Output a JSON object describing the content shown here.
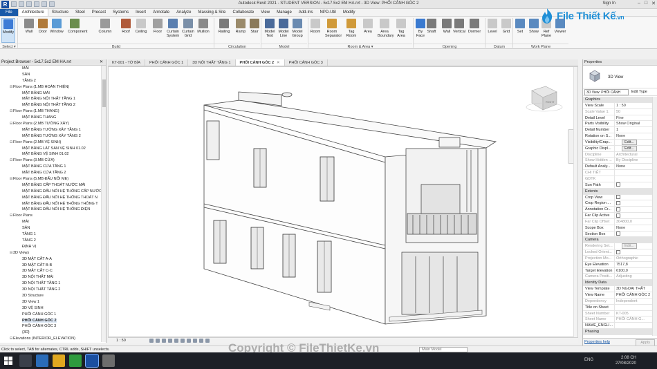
{
  "titlebar": {
    "app_title": "Autodesk Revit 2021 - STUDENT VERSION - 5x17.5x2 EM HA.rvt - 3D View: PHỐI CẢNH GÓC 2",
    "sign_in": "Sign In"
  },
  "brand": {
    "name": "File Thiết Kế",
    "suffix": ".vn"
  },
  "ribbon_tabs": [
    "File",
    "Architecture",
    "Structure",
    "Steel",
    "Precast",
    "Systems",
    "Insert",
    "Annotate",
    "Analyze",
    "Massing & Site",
    "Collaborate",
    "View",
    "Manage",
    "Add-Ins",
    "NPD-Util",
    "Modify"
  ],
  "ribbon_tools": [
    {
      "label": "Modify",
      "icon": "modify-cursor-icon"
    },
    {
      "label": "Wall",
      "icon": "wall-icon"
    },
    {
      "label": "Door",
      "icon": "door-icon"
    },
    {
      "label": "Window",
      "icon": "window-icon"
    },
    {
      "label": "Component",
      "icon": "component-icon"
    },
    {
      "label": "Column",
      "icon": "column-icon"
    },
    {
      "label": "Roof",
      "icon": "roof-icon"
    },
    {
      "label": "Ceiling",
      "icon": "ceiling-icon"
    },
    {
      "label": "Floor",
      "icon": "floor-icon"
    },
    {
      "label": "Curtain System",
      "icon": "curtain-system-icon"
    },
    {
      "label": "Curtain Grid",
      "icon": "curtain-grid-icon"
    },
    {
      "label": "Mullion",
      "icon": "mullion-icon"
    },
    {
      "label": "Railing",
      "icon": "railing-icon"
    },
    {
      "label": "Ramp",
      "icon": "ramp-icon"
    },
    {
      "label": "Stair",
      "icon": "stair-icon"
    },
    {
      "label": "Model Text",
      "icon": "model-text-icon"
    },
    {
      "label": "Model Line",
      "icon": "model-line-icon"
    },
    {
      "label": "Model Group",
      "icon": "model-group-icon"
    },
    {
      "label": "Room",
      "icon": "room-icon"
    },
    {
      "label": "Room Separator",
      "icon": "room-separator-icon"
    },
    {
      "label": "Tag Room",
      "icon": "tag-room-icon"
    },
    {
      "label": "Area",
      "icon": "area-icon"
    },
    {
      "label": "Area Boundary",
      "icon": "area-boundary-icon"
    },
    {
      "label": "Tag Area",
      "icon": "tag-area-icon"
    },
    {
      "label": "By Face",
      "icon": "by-face-icon"
    },
    {
      "label": "Shaft",
      "icon": "shaft-icon"
    },
    {
      "label": "Wall",
      "icon": "opening-wall-icon"
    },
    {
      "label": "Vertical",
      "icon": "vertical-icon"
    },
    {
      "label": "Dormer",
      "icon": "dormer-icon"
    },
    {
      "label": "Level",
      "icon": "level-icon"
    },
    {
      "label": "Grid",
      "icon": "grid-icon"
    },
    {
      "label": "Set",
      "icon": "set-icon"
    },
    {
      "label": "Show",
      "icon": "show-icon"
    },
    {
      "label": "Ref Plane",
      "icon": "ref-plane-icon"
    },
    {
      "label": "Viewer",
      "icon": "viewer-icon"
    }
  ],
  "ribbon_groups": [
    "Select ▾",
    "Build",
    "Circulation",
    "Model",
    "Room & Area ▾",
    "Opening",
    "Datum",
    "Work Plane"
  ],
  "project_browser": {
    "title": "Project Browser - 5x17.5x2 EM HA.rvt",
    "items": [
      {
        "label": "MÁI",
        "level": 2
      },
      {
        "label": "SÂN",
        "level": 2
      },
      {
        "label": "TẦNG 2",
        "level": 2
      },
      {
        "label": "Floor Plans (1.MB HOÀN THIỆN)",
        "level": 1
      },
      {
        "label": "MẶT BẰNG MÁI",
        "level": 2
      },
      {
        "label": "MẶT BẰNG NỘI THẤT TẦNG 1",
        "level": 2
      },
      {
        "label": "MẶT BẰNG NỘI THẤT TẦNG 2",
        "level": 2
      },
      {
        "label": "Floor Plans (1.MB THANG)",
        "level": 1
      },
      {
        "label": "MẶT BẰNG THANG",
        "level": 2
      },
      {
        "label": "Floor Plans (2.MB TƯỜNG XÂY)",
        "level": 1
      },
      {
        "label": "MẶT BẰNG TƯỜNG XÂY TẦNG 1",
        "level": 2
      },
      {
        "label": "MẶT BẰNG TƯỜNG XÂY TẦNG 2",
        "level": 2
      },
      {
        "label": "Floor Plans (2.MB VỆ SINH)",
        "level": 1
      },
      {
        "label": "MẶT BẰNG LÁT SÀN VỆ SINH 01.02",
        "level": 2
      },
      {
        "label": "MẶT BẰNG VỆ SINH 01.02",
        "level": 2
      },
      {
        "label": "Floor Plans (3.MB CỬA)",
        "level": 1
      },
      {
        "label": "MẶT BẰNG CỬA TẦNG 1",
        "level": 2
      },
      {
        "label": "MẶT BẰNG CỬA TẦNG 2",
        "level": 2
      },
      {
        "label": "Floor Plans (5.MB ĐẤU NỐI ME)",
        "level": 1
      },
      {
        "label": "MẶT BẰNG CẤP THOÁT NƯỚC MÁI",
        "level": 2
      },
      {
        "label": "MẶT BẰNG ĐẤU NỐI HỆ THỐNG CẤP NƯỚC",
        "level": 2
      },
      {
        "label": "MẶT BẰNG ĐẤU NỐI HỆ THỐNG THOÁT N",
        "level": 2
      },
      {
        "label": "MẶT BẰNG ĐẤU NỐI HỆ THỐNG THÔNG T",
        "level": 2
      },
      {
        "label": "MẶT BẰNG ĐẤU NỐI HỆ THỐNG ĐIỆN",
        "level": 2
      },
      {
        "label": "Floor Plans",
        "level": 1
      },
      {
        "label": "MÁI",
        "level": 2
      },
      {
        "label": "SÂN",
        "level": 2
      },
      {
        "label": "TẦNG 1",
        "level": 2
      },
      {
        "label": "TẦNG 2",
        "level": 2
      },
      {
        "label": "ĐỊNH VỊ",
        "level": 2
      },
      {
        "label": "3D Views",
        "level": 1
      },
      {
        "label": "3D MẶT CẮT A-A",
        "level": 2
      },
      {
        "label": "3D MẶT CẮT B-B",
        "level": 2
      },
      {
        "label": "3D MẶT CẮT C-C",
        "level": 2
      },
      {
        "label": "3D NỘI THẤT MÁI",
        "level": 2
      },
      {
        "label": "3D NỘI THẤT TẦNG 1",
        "level": 2
      },
      {
        "label": "3D NỘI THẤT TẦNG 2",
        "level": 2
      },
      {
        "label": "3D Structure",
        "level": 2
      },
      {
        "label": "3D View 1",
        "level": 2
      },
      {
        "label": "3D VỆ SINH",
        "level": 2
      },
      {
        "label": "PHỐI CẢNH GÓC 1",
        "level": 2
      },
      {
        "label": "PHỐI CẢNH GÓC 2",
        "level": 2,
        "selected": true
      },
      {
        "label": "PHỐI CẢNH GÓC 3",
        "level": 2
      },
      {
        "label": "{3D}",
        "level": 2
      },
      {
        "label": "Elevations (INTERIOR_ELEVATION)",
        "level": 1
      }
    ]
  },
  "view_tabs": [
    {
      "label": "KT-001 - TỜ BÌA",
      "active": false
    },
    {
      "label": "PHỐI CẢNH GÓC 1",
      "active": false
    },
    {
      "label": "3D NỘI THẤT TẦNG 1",
      "active": false
    },
    {
      "label": "PHỐI CẢNH GÓC 2",
      "active": true
    },
    {
      "label": "PHỐI CẢNH GÓC 3",
      "active": false
    }
  ],
  "viewcube": {
    "face_label": "RIGHT"
  },
  "view_control": {
    "scale": "1 : 50"
  },
  "properties": {
    "title": "Properties",
    "type_name": "3D View",
    "instance_selector": "3D View: PHỐI CẢNH",
    "edit_type": "Edit Type",
    "rows": [
      {
        "cat": "Graphics"
      },
      {
        "k": "View Scale",
        "v": "1 : 50"
      },
      {
        "k": "Scale Value    1:",
        "v": "50",
        "grey": true
      },
      {
        "k": "Detail Level",
        "v": "Fine"
      },
      {
        "k": "Parts Visibility",
        "v": "Show Original"
      },
      {
        "k": "Detail Number",
        "v": "1"
      },
      {
        "k": "Rotation on S...",
        "v": "None"
      },
      {
        "k": "Visibility/Grap...",
        "btn": "Edit..."
      },
      {
        "k": "Graphic Displ...",
        "btn": "Edit..."
      },
      {
        "k": "Discipline",
        "v": "Architectural",
        "grey": true
      },
      {
        "k": "Show Hidden ...",
        "v": "By Discipline",
        "grey": true
      },
      {
        "k": "Default Analy...",
        "v": "None"
      },
      {
        "k": "CHI TIẾT",
        "v": "",
        "grey": true
      },
      {
        "k": "GDTK",
        "v": "",
        "grey": true
      },
      {
        "k": "Sun Path",
        "chk": true
      },
      {
        "cat": "Extents"
      },
      {
        "k": "Crop View",
        "chk": true
      },
      {
        "k": "Crop Region ...",
        "chk": true
      },
      {
        "k": "Annotation Cr...",
        "chk": true
      },
      {
        "k": "Far Clip Active",
        "chk": true
      },
      {
        "k": "Far Clip Offset",
        "v": "304800,0",
        "grey": true
      },
      {
        "k": "Scope Box",
        "v": "None"
      },
      {
        "k": "Section Box",
        "chk": true
      },
      {
        "cat": "Camera"
      },
      {
        "k": "Rendering Set...",
        "btn": "Edit...",
        "grey": true
      },
      {
        "k": "Locked Orient...",
        "chk": true,
        "grey": true
      },
      {
        "k": "Projection Mo...",
        "v": "Orthographic",
        "grey": true
      },
      {
        "k": "Eye Elevation",
        "v": "7517,8"
      },
      {
        "k": "Target Elevation",
        "v": "6100,0"
      },
      {
        "k": "Camera Positi...",
        "v": "Adjusting",
        "grey": true
      },
      {
        "cat": "Identity Data"
      },
      {
        "k": "View Template",
        "v": "3D NGOẠI THẤT"
      },
      {
        "k": "View Name",
        "v": "PHỐI CẢNH GÓC 2"
      },
      {
        "k": "Dependency",
        "v": "Independent",
        "grey": true
      },
      {
        "k": "Title on Sheet",
        "v": ""
      },
      {
        "k": "Sheet Number",
        "v": "KT-005",
        "grey": true
      },
      {
        "k": "Sheet Name",
        "v": "PHỐI CẢNH G...",
        "grey": true
      },
      {
        "k": "NAME_ENGLI...",
        "v": ""
      },
      {
        "cat": "Phasing"
      }
    ],
    "help_link": "Properties help",
    "apply": "Apply"
  },
  "statusbar": {
    "message": "Click to select, TAB for alternates, CTRL adds, SHIFT unselects.",
    "model": "Main Model"
  },
  "taskbar": {
    "time": "2:08 CH",
    "date": "27/08/2020",
    "lang": "ENG"
  },
  "watermark": "Copyright © FileThietKe.vn",
  "colors": {
    "file_tab": "#1a5aa8",
    "brand": "#1f8fd6",
    "taskbar": "#1c1f26"
  }
}
